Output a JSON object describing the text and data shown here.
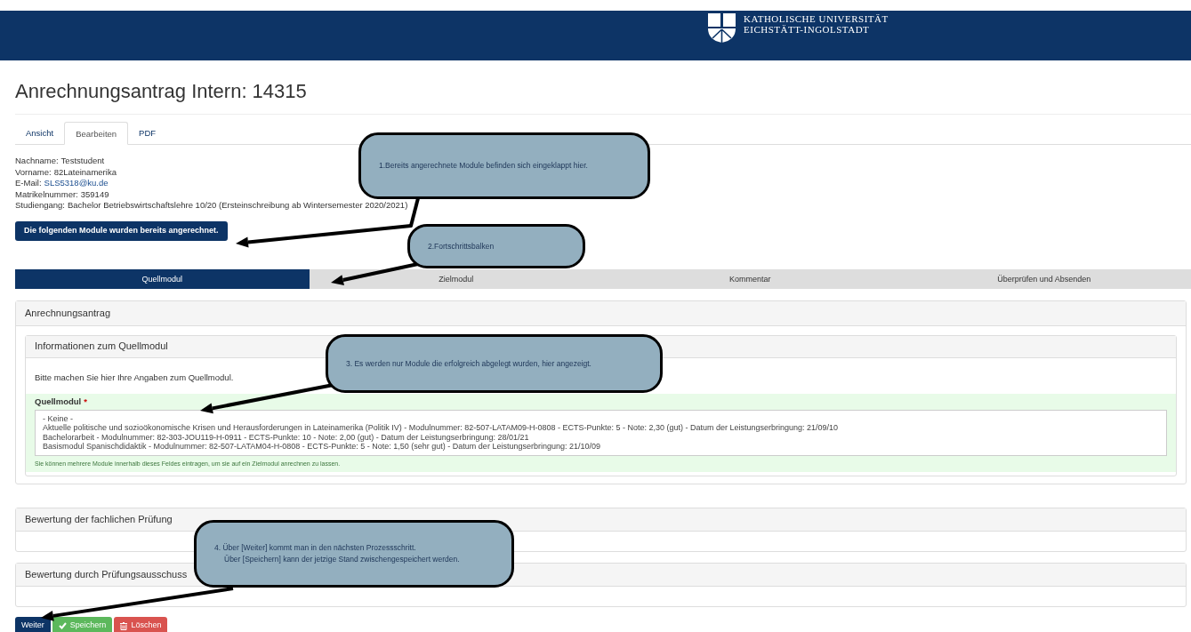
{
  "header": {
    "logo_lines": [
      "KATHOLISCHE UNIVERSITÄT",
      "EICHSTÄTT-INGOLSTADT"
    ]
  },
  "title": "Anrechnungsantrag Intern: 14315",
  "tabs": [
    {
      "label": "Ansicht",
      "selected": false
    },
    {
      "label": "Bearbeiten",
      "selected": true
    },
    {
      "label": "PDF",
      "selected": false
    }
  ],
  "student": [
    {
      "label": "Nachname:",
      "value": "Teststudent",
      "kind": "text"
    },
    {
      "label": "Vorname:",
      "value": "82Lateinamerika",
      "kind": "text"
    },
    {
      "label": "E-Mail:",
      "value": "SLS5318@ku.de",
      "kind": "link"
    },
    {
      "label": "Matrikelnummer:",
      "value": "359149",
      "kind": "text"
    },
    {
      "label": "Studiengang:",
      "value": "Bachelor Betriebswirtschaftslehre 10/20 (Ersteinschreibung ab Wintersemester 2020/2021)",
      "kind": "text"
    }
  ],
  "credited_button": "Die folgenden Module wurden bereits angerechnet.",
  "steps": [
    {
      "label": "Quellmodul",
      "selected": true
    },
    {
      "label": "Zielmodul",
      "selected": false
    },
    {
      "label": "Kommentar",
      "selected": false
    },
    {
      "label": "Überprüfen und Absenden",
      "selected": false
    }
  ],
  "panel": {
    "title": "Anrechnungsantrag",
    "subpanel": {
      "title": "Informationen zum Quellmodul",
      "intro": "Bitte machen Sie hier Ihre Angaben zum Quellmodul.",
      "field": {
        "label": "Quellmodul",
        "required": true,
        "required_mark": "*",
        "options": [
          "- Keine -",
          "Aktuelle politische und sozioökonomische Krisen und Herausforderungen in Lateinamerika (Politik IV) - Modulnummer: 82-507-LATAM09-H-0808 - ECTS-Punkte: 5 - Note: 2,30 (gut) - Datum der Leistungserbringung: 21/09/10",
          "Bachelorarbeit - Modulnummer: 82-303-JOU119-H-0911 - ECTS-Punkte: 10 - Note: 2,00 (gut) - Datum der Leistungserbringung: 28/01/21",
          "Basismodul Spanischdidaktik - Modulnummer: 82-507-LATAM04-H-0808 - ECTS-Punkte: 5 - Note: 1,50 (sehr gut) - Datum der Leistungserbringung: 21/10/09"
        ],
        "hint": "Sie können mehrere Module innerhalb dieses Feldes eintragen, um sie auf ein Zielmodul anrechnen zu lassen."
      }
    }
  },
  "sections": [
    {
      "title": "Bewertung der fachlichen Prüfung"
    },
    {
      "title": "Bewertung durch Prüfungsausschuss"
    }
  ],
  "buttons": [
    {
      "label": "Weiter",
      "kind": "primary"
    },
    {
      "label": "Speichern",
      "kind": "save"
    },
    {
      "label": "Löschen",
      "kind": "delete"
    }
  ],
  "callouts": [
    {
      "lines": [
        "1.Bereits angerechnete Module befinden sich eingeklappt hier."
      ]
    },
    {
      "lines": [
        "2.Fortschrittsbalken"
      ]
    },
    {
      "lines": [
        "3. Es werden nur Module die erfolgreich abgelegt wurden, hier angezeigt."
      ]
    },
    {
      "lines": [
        "4. Über [Weiter] kommt man in den nächsten Prozessschritt.",
        "Über [Speichern] kann der jetzige Stand zwischengespeichert werden."
      ]
    }
  ]
}
